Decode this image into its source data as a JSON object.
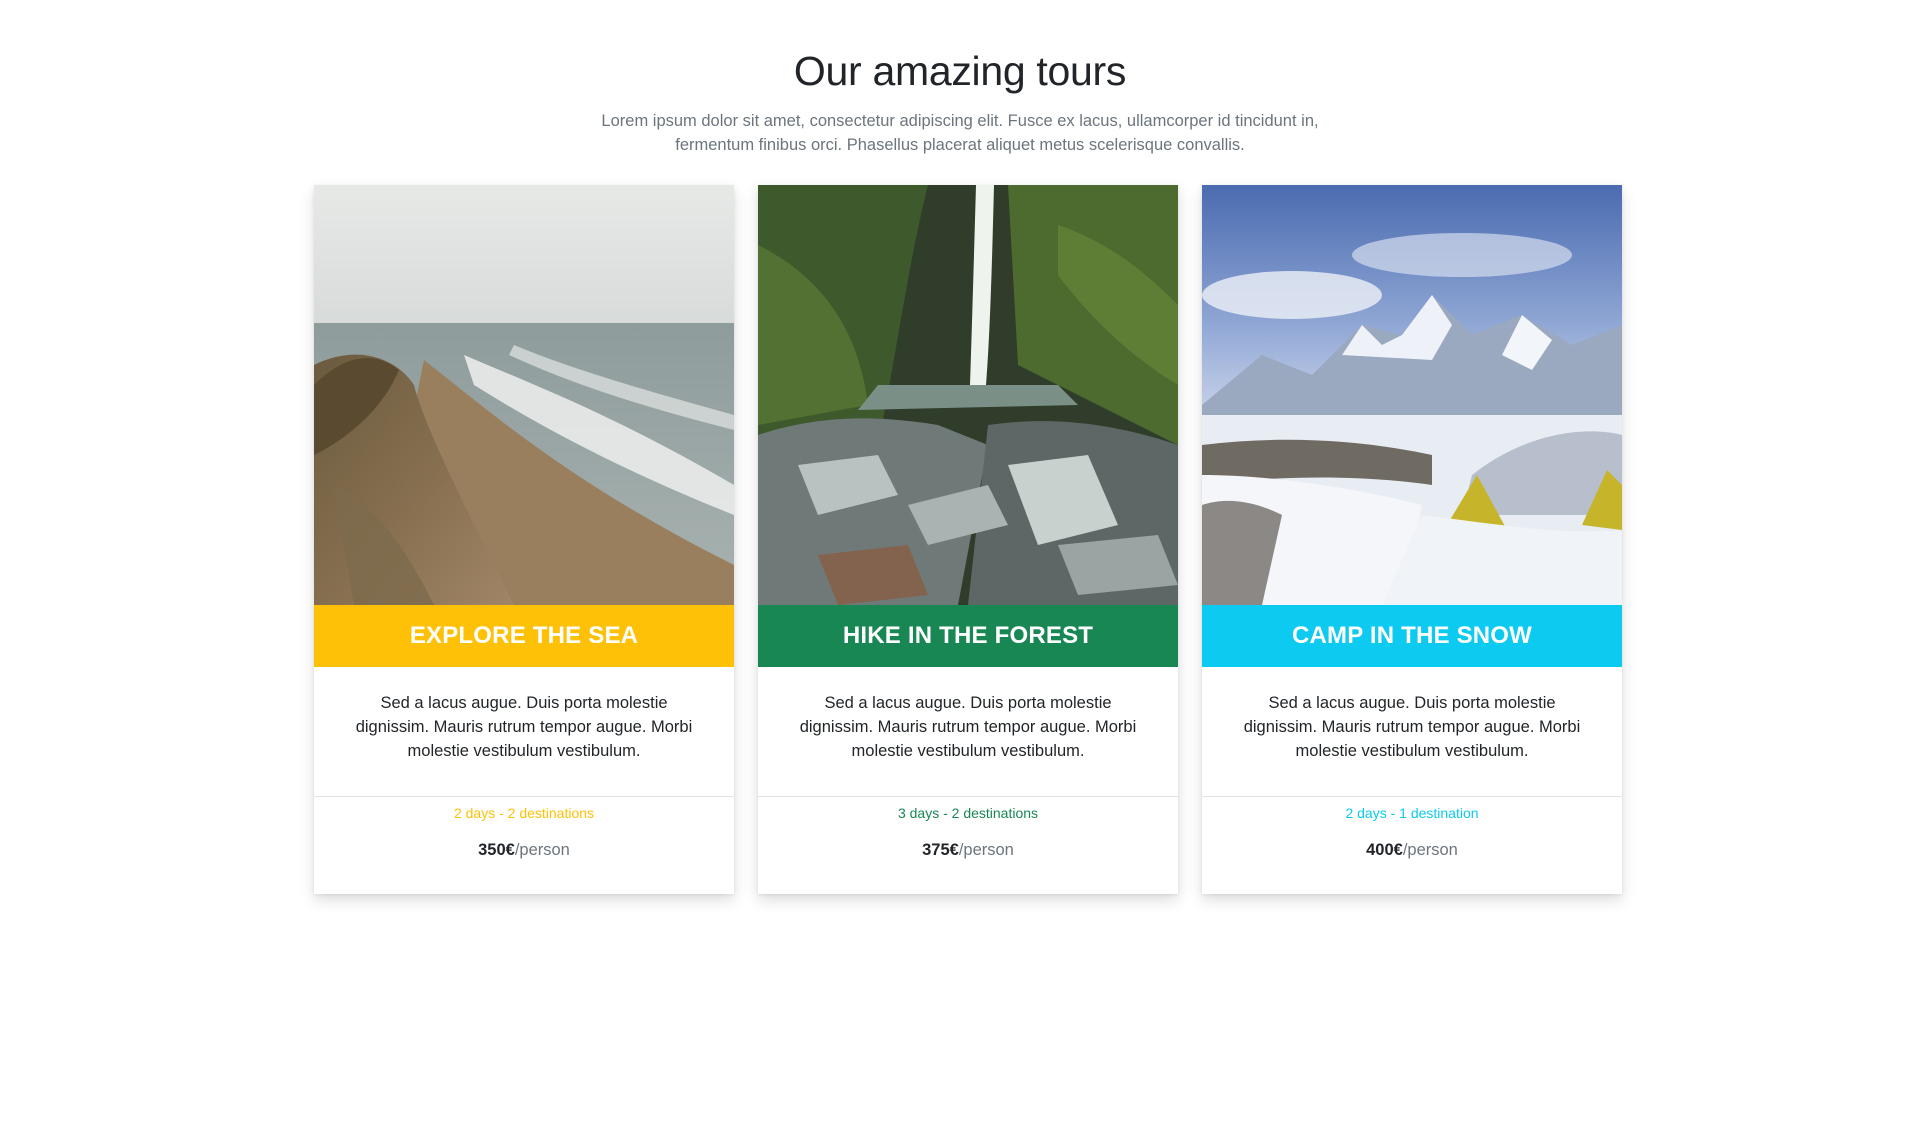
{
  "header": {
    "title": "Our amazing tours",
    "subtitle": "Lorem ipsum dolor sit amet, consectetur adipiscing elit. Fusce ex lacus, ullamcorper id tincidunt in, fermentum finibus orci. Phasellus placerat aliquet metus scelerisque convallis."
  },
  "tours": [
    {
      "title": "EXPLORE THE SEA",
      "description": "Sed a lacus augue. Duis porta molestie dignissim. Mauris rutrum tempor augue. Morbi molestie vestibulum vestibulum.",
      "meta": "2 days - 2 destinations",
      "price": "350€",
      "price_unit": "/person",
      "accent_color": "#ffc107",
      "image": "sea-cliff-photo"
    },
    {
      "title": "HIKE IN THE FOREST",
      "description": "Sed a lacus augue. Duis porta molestie dignissim. Mauris rutrum tempor augue. Morbi molestie vestibulum vestibulum.",
      "meta": "3 days - 2 destinations",
      "price": "375€",
      "price_unit": "/person",
      "accent_color": "#198754",
      "image": "forest-waterfall-photo"
    },
    {
      "title": "CAMP IN THE SNOW",
      "description": "Sed a lacus augue. Duis porta molestie dignissim. Mauris rutrum tempor augue. Morbi molestie vestibulum vestibulum.",
      "meta": "2 days - 1 destination",
      "price": "400€",
      "price_unit": "/person",
      "accent_color": "#0dcaf0",
      "image": "snow-camp-photo"
    }
  ]
}
